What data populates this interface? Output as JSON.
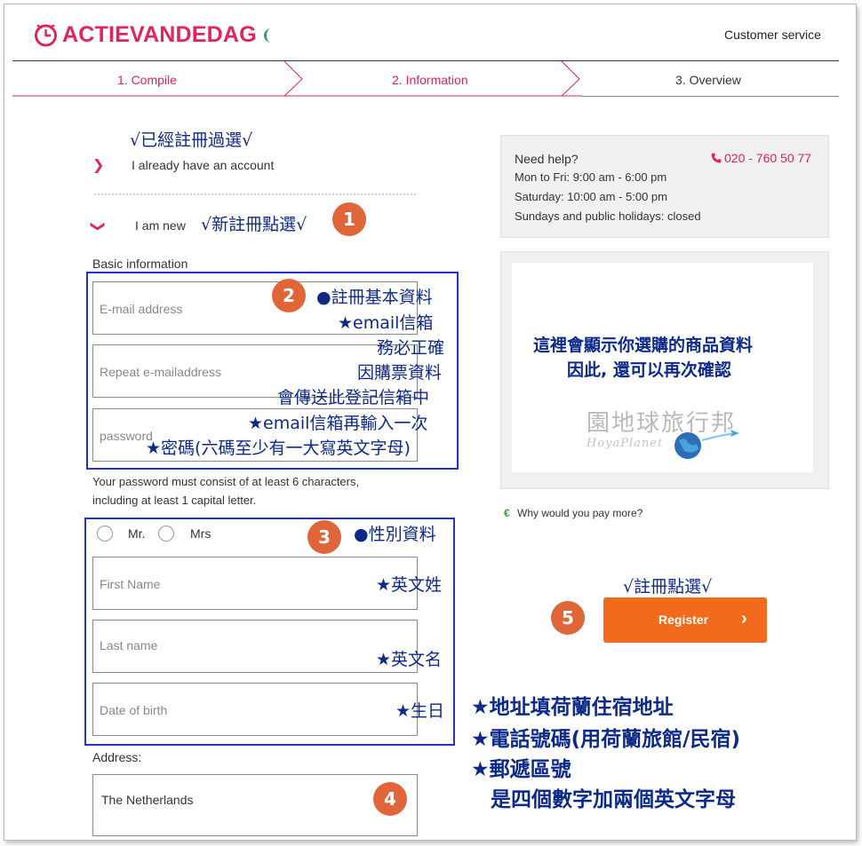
{
  "header": {
    "logo_text": "ACTIEVANDEDAG",
    "customer_service": "Customer service",
    "brand_color": "#e0245e"
  },
  "steps": [
    {
      "label": "1. Compile",
      "active": false
    },
    {
      "label": "2. Information",
      "active": true
    },
    {
      "label": "3. Overview",
      "active": false
    }
  ],
  "account": {
    "existing_annot": "√已經註冊過選√",
    "existing_label": "I already have an account",
    "new_label": "I am new",
    "new_annot": "√新註冊點選√"
  },
  "basic": {
    "heading": "Basic information",
    "email_placeholder": "E-mail address",
    "repeat_placeholder": "Repeat e-mailaddress",
    "password_placeholder": "password",
    "password_hint_line1": "Your password must consist of at least 6 characters,",
    "password_hint_line2": "including at least 1 capital letter."
  },
  "annot_basic": {
    "l1": "●註冊基本資料",
    "l2": "★email信箱",
    "l3": "務必正確",
    "l4": "因購票資料",
    "l5": "會傳送此登記信箱中",
    "l6": "★email信箱再輸入一次",
    "l7": "★密碼(六碼至少有一大寫英文字母)"
  },
  "personal": {
    "mr": "Mr.",
    "mrs": "Mrs",
    "first_name_placeholder": "First Name",
    "last_name_placeholder": "Last name",
    "dob_placeholder": "Date of birth",
    "annot_gender": "●性別資料",
    "annot_first": "★英文姓",
    "annot_last": "★英文名",
    "annot_dob": "★生日"
  },
  "address": {
    "heading": "Address:",
    "country_value": "The Netherlands"
  },
  "annot_address": {
    "l1": "★地址填荷蘭住宿地址",
    "l2": "★電話號碼(用荷蘭旅館/民宿)",
    "l3": "★郵遞區號",
    "l4": "是四個數字加兩個英文字母"
  },
  "numbers": [
    "1",
    "2",
    "3",
    "4",
    "5"
  ],
  "help": {
    "title": "Need help?",
    "phone": "020 - 760 50 77",
    "weekday": "Mon to Fri: 9:00 am - 6:00 pm",
    "saturday": "Saturday: 10:00 am - 5:00 pm",
    "sunday": "Sundays and public holidays: closed"
  },
  "product": {
    "note_l1": "這裡會顯示你選購的商品資料",
    "note_l2": "因此, 還可以再次確認",
    "watermark_cn": "園地球旅行邦",
    "watermark_en": "HoyaPlanet"
  },
  "why_pay": {
    "symbol": "€",
    "text": "Why would you pay more?"
  },
  "register": {
    "annot": "√註冊點選√",
    "label": "Register"
  },
  "colors": {
    "accent": "#e0245e",
    "annotation": "#0d2a8a",
    "annotation_box": "#2233cc",
    "number_badge": "#e0663a",
    "register_button": "#f26a1b",
    "euro_green": "#3aa13a"
  }
}
